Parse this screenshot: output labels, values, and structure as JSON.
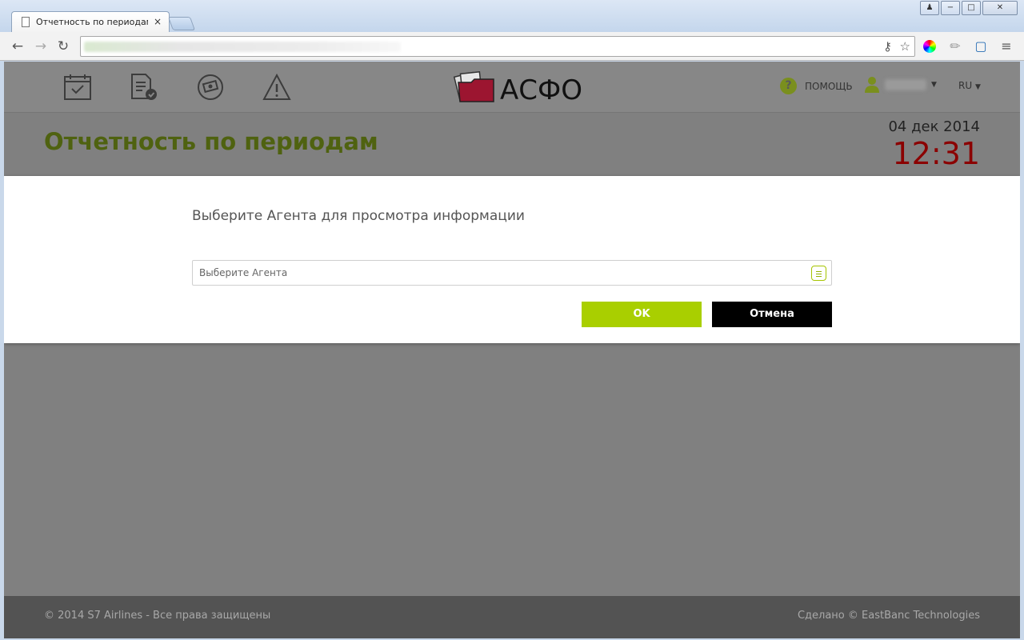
{
  "browser": {
    "tab_title": "Отчетность по периодам |",
    "tab_close": "×",
    "window_buttons": [
      "♟",
      "−",
      "□",
      "✕"
    ]
  },
  "header": {
    "logo_text": "АСФО",
    "help_label": "ПОМОЩЬ",
    "lang": "RU"
  },
  "title_bar": {
    "page_title": "Отчетность по периодам",
    "date": "04 дек 2014",
    "time": "12:31"
  },
  "modal": {
    "heading": "Выберите Агента для просмотра информации",
    "agent_placeholder": "Выберите Агента",
    "ok_label": "OK",
    "cancel_label": "Отмена"
  },
  "footer": {
    "copyright": "© 2014 S7 Airlines - Все права защищены",
    "made_by": "Сделано © EastBanc Technologies"
  },
  "colors": {
    "accent_green": "#a9cf00",
    "title_green": "#4f6210",
    "clock_red": "#8b0000",
    "logo_red": "#9c1530"
  }
}
